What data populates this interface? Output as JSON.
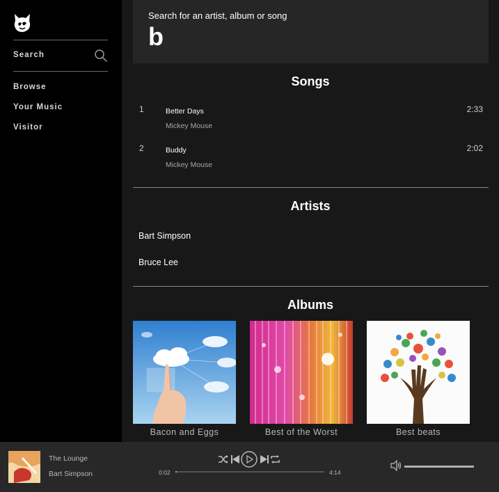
{
  "sidebar": {
    "logo_icon": "cat-head-logo",
    "search_label": "Search",
    "nav": [
      "Browse",
      "Your Music",
      "Visitor"
    ]
  },
  "search": {
    "prompt": "Search for an artist, album or song",
    "query": "b"
  },
  "songs": {
    "title": "Songs",
    "items": [
      {
        "num": "1",
        "title": "Better Days",
        "artist": "Mickey Mouse",
        "duration": "2:33"
      },
      {
        "num": "2",
        "title": "Buddy",
        "artist": "Mickey Mouse",
        "duration": "2:02"
      }
    ]
  },
  "artists": {
    "title": "Artists",
    "items": [
      "Bart Simpson",
      "Bruce Lee"
    ]
  },
  "albums": {
    "title": "Albums",
    "items": [
      {
        "name": "Bacon and Eggs",
        "art": "hand-touching-cloud-network"
      },
      {
        "name": "Best of the Worst",
        "art": "colorful-light-streaks"
      },
      {
        "name": "Best beats",
        "art": "tree-of-painted-hands"
      }
    ]
  },
  "player": {
    "track_title": "The Lounge",
    "track_artist": "Bart Simpson",
    "elapsed": "0:02",
    "total": "4:14",
    "progress_fraction": 0.008,
    "volume_fraction": 1.0,
    "controls": [
      "shuffle-icon",
      "previous-icon",
      "play-icon",
      "next-icon",
      "repeat-icon"
    ]
  },
  "colors": {
    "sidebar_bg": "#000000",
    "main_bg": "#181818",
    "search_bg": "#262626",
    "player_bg": "#282828"
  }
}
